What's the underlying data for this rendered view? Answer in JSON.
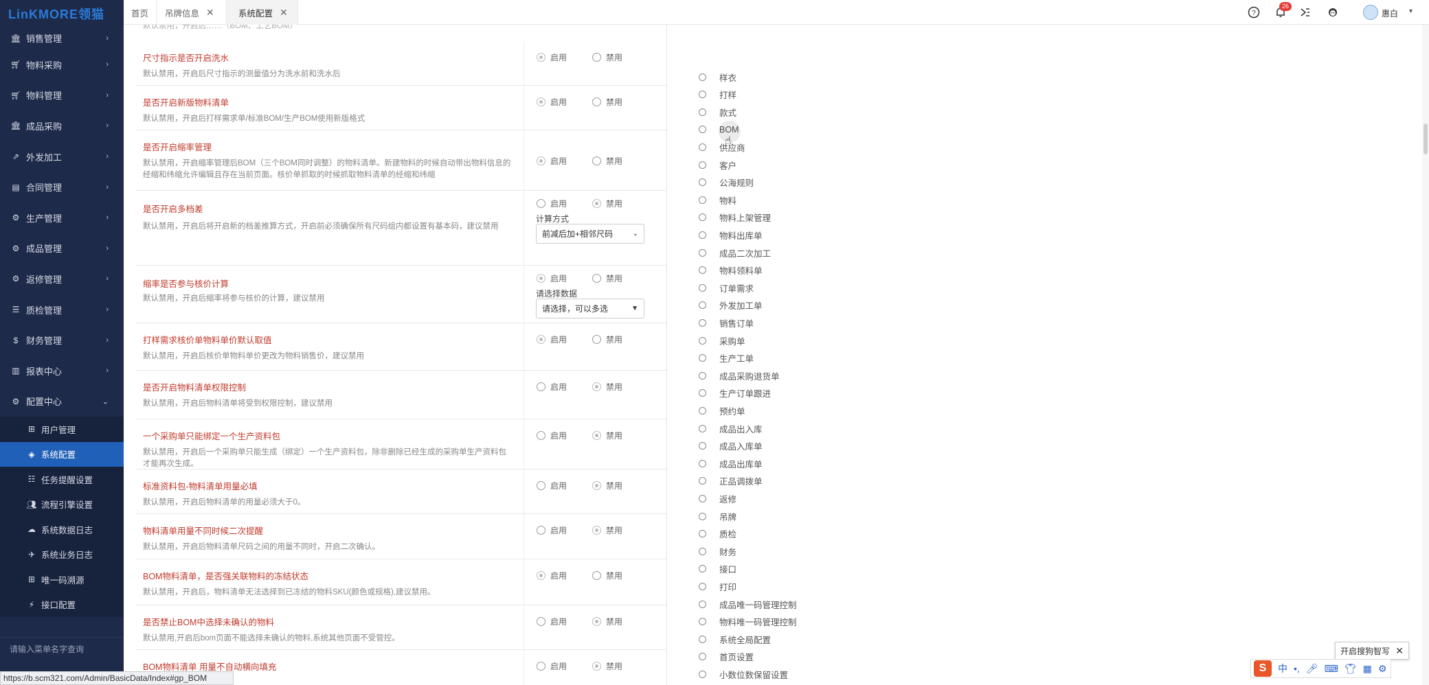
{
  "app": {
    "logo": "LinKMORE领猫",
    "brand_color": "#2a7bd9",
    "sidebar_bg": "#1e2a4a",
    "active_color": "#2160b8"
  },
  "sidebar": {
    "items": [
      {
        "label": "销售管理",
        "icon": "bank-icon"
      },
      {
        "label": "物料采购",
        "icon": "cart-icon"
      },
      {
        "label": "物料管理",
        "icon": "cart-icon"
      },
      {
        "label": "成品采购",
        "icon": "bank-icon"
      },
      {
        "label": "外发加工",
        "icon": "external-link-icon"
      },
      {
        "label": "合同管理",
        "icon": "contract-icon"
      },
      {
        "label": "生产管理",
        "icon": "gears-icon"
      },
      {
        "label": "成品管理",
        "icon": "gears-icon"
      },
      {
        "label": "返修管理",
        "icon": "gears-icon"
      },
      {
        "label": "质检管理",
        "icon": "list-icon"
      },
      {
        "label": "财务管理",
        "icon": "dollar-icon"
      },
      {
        "label": "报表中心",
        "icon": "bar-chart-icon"
      },
      {
        "label": "配置中心",
        "icon": "gears-icon"
      }
    ],
    "sub_items": [
      {
        "label": "用户管理",
        "icon": "sitemap-icon"
      },
      {
        "label": "系统配置",
        "icon": "cube-icon"
      },
      {
        "label": "任务提醒设置",
        "icon": "sliders-icon"
      },
      {
        "label": "流程引擎设置",
        "icon": "users-icon"
      },
      {
        "label": "系统数据日志",
        "icon": "cloud-icon"
      },
      {
        "label": "系统业务日志",
        "icon": "plane-icon"
      },
      {
        "label": "唯一码溯源",
        "icon": "sitemap-icon"
      },
      {
        "label": "接口配置",
        "icon": "plug-icon"
      }
    ],
    "search_placeholder": "请输入菜单名字查询"
  },
  "status_url": "https://b.scm321.com/Admin/BasicData/Index#gp_BOM",
  "tabs": [
    {
      "label": "首页",
      "closable": false
    },
    {
      "label": "吊牌信息",
      "closable": true
    },
    {
      "label": "系统配置",
      "closable": true,
      "active": true
    }
  ],
  "topbar": {
    "notification_count": "26",
    "user_name": "惠白"
  },
  "top_cut_text": "默认禁用，开启后……（BOM、工艺BOM）",
  "settings": [
    {
      "title": "尺寸指示是否开启洗水",
      "desc": "默认禁用，开启后尺寸指示的测量值分为洗水前和洗水后",
      "enabled": true
    },
    {
      "title": "是否开启新版物料清单",
      "desc": "默认禁用，开启后打样需求单/标准BOM/生产BOM使用新版格式",
      "enabled": true
    },
    {
      "title": "是否开启缩率管理",
      "desc": "默认禁用，开启缩率管理后BOM（三个BOM同时调整）的物料清单。新建物料的时候自动带出物料信息的经缩和纬缩允许编辑且存在当前页面。核价单抓取的时候抓取物料清单的经缩和纬缩",
      "enabled": true
    },
    {
      "title": "是否开启多档差",
      "desc": "默认禁用，开启后将开启新的档差推算方式，开启前必须确保所有尺码组内都设置有基本码，建议禁用",
      "enabled": false,
      "select_label": "计算方式",
      "select_value": "前减后加+相邻尺码"
    },
    {
      "title": "缩率是否参与核价计算",
      "desc": "默认禁用，开启后缩率将参与核价的计算，建议禁用",
      "enabled": true,
      "select_label": "请选择数据",
      "select_value": "请选择，可以多选"
    },
    {
      "title": "打样需求核价单物料单价默认取值",
      "desc": "默认禁用，开启后核价单物料单价更改为物料销售价，建议禁用",
      "enabled": true
    },
    {
      "title": "是否开启物料清单权限控制",
      "desc": "默认禁用，开启后物料清单将受到权限控制，建议禁用",
      "enabled": false
    },
    {
      "title": "一个采购单只能绑定一个生产资料包",
      "desc": "默认禁用，开启后一个采购单只能生成（绑定）一个生产资料包，除非删除已经生成的采购单生产资料包才能再次生成。",
      "enabled": false
    },
    {
      "title": "标准资料包-物料清单用量必填",
      "desc": "默认禁用，开启后物料清单的用量必须大于0。",
      "enabled": false
    },
    {
      "title": "物料清单用量不同时候二次提醒",
      "desc": "默认禁用，开启后物料清单尺码之间的用量不同时，开启二次确认。",
      "enabled": false
    },
    {
      "title": "BOM物料清单，是否强关联物料的冻结状态",
      "desc": "默认禁用，开启后，物料清单无法选择到已冻结的物料SKU(颜色或规格),建议禁用。",
      "enabled": true
    },
    {
      "title": "是否禁止BOM中选择未确认的物料",
      "desc": "默认禁用,开启后bom页面不能选择未确认的物料,系统其他页面不受管控。",
      "enabled": false
    },
    {
      "title": "BOM物料清单 用量不自动横向填充",
      "desc": "",
      "enabled": false
    }
  ],
  "radio_labels": {
    "on": "启用",
    "off": "禁用"
  },
  "right_list": [
    "样衣",
    "打样",
    "款式",
    "BOM",
    "供应商",
    "客户",
    "公海规则",
    "物料",
    "物料上架管理",
    "物料出库单",
    "成品二次加工",
    "物料领料单",
    "订单需求",
    "外发加工单",
    "销售订单",
    "采购单",
    "生产工单",
    "成品采购退货单",
    "生产订单跟进",
    "预约单",
    "成品出入库",
    "成品入库单",
    "成品出库单",
    "正品调拨单",
    "返修",
    "吊牌",
    "质检",
    "财务",
    "接口",
    "打印",
    "成品唯一码管理控制",
    "物料唯一码管理控制",
    "系统全局配置",
    "首页设置",
    "小数位数保留设置"
  ],
  "ime": {
    "tip": "开启搜狗智写",
    "logo": "S",
    "lang": "中"
  }
}
